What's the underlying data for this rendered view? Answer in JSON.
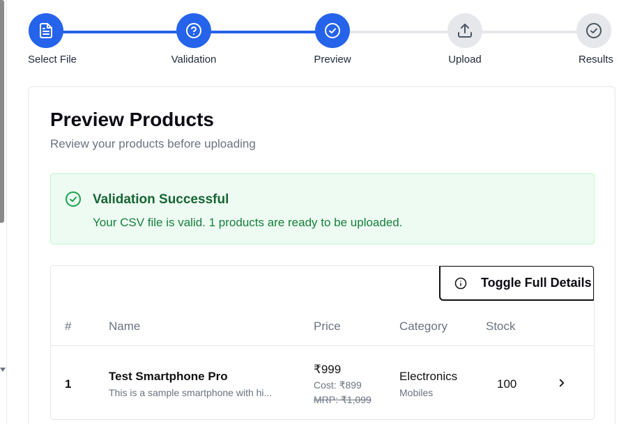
{
  "stepper": {
    "steps": [
      {
        "label": "Select File",
        "state": "complete",
        "icon": "file-text-icon"
      },
      {
        "label": "Validation",
        "state": "complete",
        "icon": "help-circle-icon"
      },
      {
        "label": "Preview",
        "state": "current",
        "icon": "check-circle-icon"
      },
      {
        "label": "Upload",
        "state": "pending",
        "icon": "upload-icon"
      },
      {
        "label": "Results",
        "state": "pending",
        "icon": "check-circle-icon"
      }
    ]
  },
  "card": {
    "title": "Preview Products",
    "subtitle": "Review your products before uploading"
  },
  "alert": {
    "title": "Validation Successful",
    "message": "Your CSV file is valid. 1 products are ready to be uploaded.",
    "icon": "check-circle-icon"
  },
  "table": {
    "toggle_label": "Toggle Full Details",
    "toggle_icon": "info-icon",
    "columns": [
      "#",
      "Name",
      "Price",
      "Category",
      "Stock"
    ],
    "rows": [
      {
        "index": "1",
        "name": "Test Smartphone Pro",
        "description": "This is a sample smartphone with hi...",
        "price": "₹999",
        "cost": "Cost: ₹899",
        "mrp": "MRP: ₹1,099",
        "category": "Electronics",
        "subcategory": "Mobiles",
        "stock": "100"
      }
    ]
  },
  "colors": {
    "accent": "#2563eb",
    "inactive": "#e5e7eb",
    "success_bg": "#eefbf2",
    "success_text": "#166534"
  }
}
